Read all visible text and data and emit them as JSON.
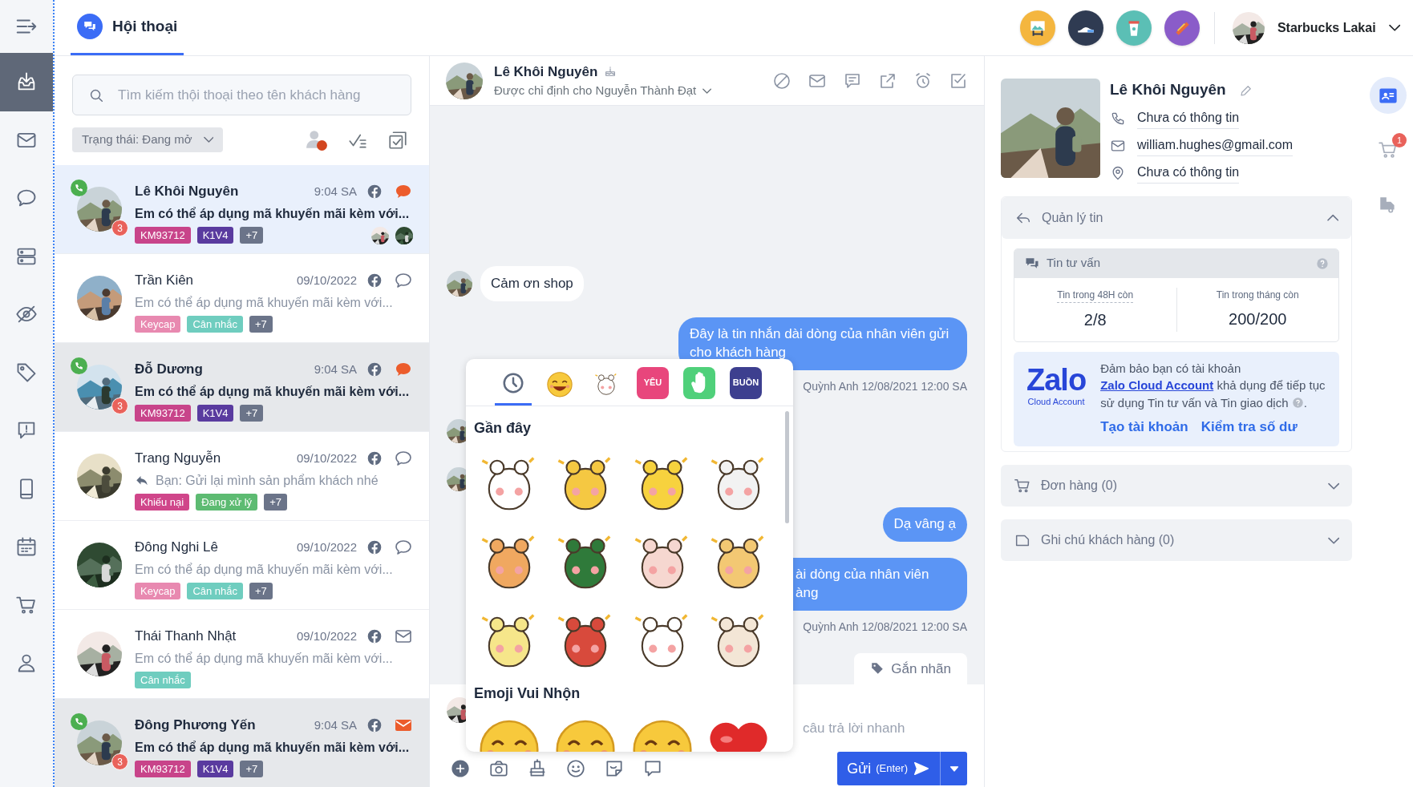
{
  "rail": {
    "items": [
      {
        "kind": "inbox",
        "selected": true
      },
      {
        "kind": "mail",
        "selected": false
      },
      {
        "kind": "chat",
        "selected": false
      },
      {
        "kind": "server",
        "selected": false
      },
      {
        "kind": "eye-off",
        "selected": false
      },
      {
        "kind": "tag",
        "selected": false
      },
      {
        "kind": "alert",
        "selected": false
      },
      {
        "kind": "mobile",
        "selected": false
      },
      {
        "kind": "calendar",
        "selected": false
      },
      {
        "kind": "cart",
        "selected": false
      },
      {
        "kind": "user",
        "selected": false
      }
    ]
  },
  "topbar": {
    "tab": {
      "label": "Hội thoại",
      "selected": true
    },
    "apps": [
      {
        "kind": "frame",
        "color": "#f4b63f"
      },
      {
        "kind": "shoe",
        "color": "#2f3b52"
      },
      {
        "kind": "cup",
        "color": "#5bbfb5"
      },
      {
        "kind": "hotdog",
        "color": "#8a5cc9"
      }
    ],
    "account": {
      "name": "Starbucks Lakai"
    }
  },
  "conversation_list": {
    "search": {
      "placeholder": "Tìm kiếm thội thoại theo tên khách hàng"
    },
    "filter": {
      "label": "Trạng thái: Đang mở"
    },
    "conversations": [
      {
        "name": "Lê Khôi Nguyên",
        "time": "9:04 SA",
        "channel": {
          "kind": "facebook"
        },
        "status_icon": {
          "kind": "chat",
          "new": true
        },
        "preview": "Em có thể áp dụng mã khuyến mãi kèm với...",
        "reply": false,
        "tags": [
          {
            "label": "KM93712",
            "color": "#c8448a"
          },
          {
            "label": "K1V4",
            "color": "#5a3b9f"
          },
          {
            "label": "+7",
            "color": "#6b7489"
          }
        ],
        "unread_count": "3",
        "on_call": true,
        "unread": true,
        "selected": true,
        "assignees": [
          {
            "kind": "picture"
          },
          {
            "kind": "picture"
          }
        ]
      },
      {
        "name": "Trần Kiên",
        "time": "09/10/2022",
        "channel": {
          "kind": "facebook"
        },
        "status_icon": {
          "kind": "chat",
          "new": false
        },
        "preview": "Em có thể áp dụng mã khuyến mãi kèm với...",
        "reply": false,
        "tags": [
          {
            "label": "Keycap",
            "color": "#e889b0"
          },
          {
            "label": "Cân nhắc",
            "color": "#6fcdbf"
          },
          {
            "label": "+7",
            "color": "#6b7489"
          }
        ],
        "on_call": false,
        "unread": false,
        "selected": false
      },
      {
        "name": "Đỗ Dương",
        "time": "9:04 SA",
        "channel": {
          "kind": "facebook"
        },
        "status_icon": {
          "kind": "chat",
          "new": true
        },
        "preview": "Em có thể áp dụng mã khuyến mãi kèm với...",
        "reply": false,
        "tags": [
          {
            "label": "KM93712",
            "color": "#c8448a"
          },
          {
            "label": "K1V4",
            "color": "#5a3b9f"
          },
          {
            "label": "+7",
            "color": "#6b7489"
          }
        ],
        "unread_count": "3",
        "on_call": true,
        "unread": true,
        "selected": false
      },
      {
        "name": "Trang Nguyễn",
        "time": "09/10/2022",
        "channel": {
          "kind": "facebook"
        },
        "status_icon": {
          "kind": "chat",
          "new": false
        },
        "preview": "Bạn: Gửi lại mình sản phẩm khách nhé",
        "reply": true,
        "tags": [
          {
            "label": "Khiếu nại",
            "color": "#d0468a"
          },
          {
            "label": "Đang xử lý",
            "color": "#5dbb72"
          },
          {
            "label": "+7",
            "color": "#6b7489"
          }
        ],
        "on_call": false,
        "unread": false,
        "selected": false
      },
      {
        "name": "Đông Nghi Lê",
        "time": "09/10/2022",
        "channel": {
          "kind": "facebook"
        },
        "status_icon": {
          "kind": "chat",
          "new": false
        },
        "preview": "Em có thể áp dụng mã khuyến mãi kèm với...",
        "reply": false,
        "tags": [
          {
            "label": "Keycap",
            "color": "#e889b0"
          },
          {
            "label": "Cân nhắc",
            "color": "#6fcdbf"
          },
          {
            "label": "+7",
            "color": "#6b7489"
          }
        ],
        "on_call": false,
        "unread": false,
        "selected": false
      },
      {
        "name": "Thái Thanh Nhật",
        "time": "09/10/2022",
        "channel": {
          "kind": "facebook"
        },
        "status_icon": {
          "kind": "mail",
          "new": false
        },
        "preview": "Em có thể áp dụng mã khuyến mãi kèm với...",
        "reply": false,
        "tags": [
          {
            "label": "Cân nhắc",
            "color": "#6fcdbf"
          }
        ],
        "on_call": false,
        "unread": false,
        "selected": false
      },
      {
        "name": "Đông Phương Yến",
        "time": "9:04 SA",
        "channel": {
          "kind": "facebook"
        },
        "status_icon": {
          "kind": "mail",
          "new": true
        },
        "preview": "Em có thể áp dụng mã khuyến mãi kèm với...",
        "reply": false,
        "tags": [
          {
            "label": "KM93712",
            "color": "#c8448a"
          },
          {
            "label": "K1V4",
            "color": "#5a3b9f"
          },
          {
            "label": "+7",
            "color": "#6b7489"
          }
        ],
        "unread_count": "3",
        "on_call": true,
        "unread": true,
        "selected": false
      }
    ]
  },
  "chat": {
    "header": {
      "name": "Lê Khôi Nguyên",
      "assigned": "Được chỉ định cho Nguyễn Thành Đạt"
    },
    "messages": [
      {
        "kind": "in",
        "text": "Cảm ơn shop"
      },
      {
        "kind": "out",
        "lines": [
          "Đây là tin nhắn dài dòng của nhân viên gửi cho khách hàng"
        ],
        "meta": "Quỳnh Anh 12/08/2021 12:00 SA"
      },
      {
        "kind": "avatar"
      },
      {
        "kind": "avatar"
      },
      {
        "kind": "out",
        "lines": [
          "Dạ vâng ạ"
        ]
      },
      {
        "kind": "out-covered",
        "lines": [
          "ài dòng của nhân viên",
          "àng"
        ],
        "meta": "Quỳnh Anh 12/08/2021 12:00 SA"
      }
    ],
    "label_tab": "Gắn nhãn",
    "composer": {
      "placeholder": "câu trả lời nhanh",
      "send": "Gửi",
      "send_hint": "(Enter)"
    },
    "sticker_picker": {
      "tabs": [
        {
          "kind": "clock",
          "selected": true
        },
        {
          "kind": "emoji",
          "selected": false
        },
        {
          "kind": "cats",
          "selected": false
        },
        {
          "kind": "badge",
          "label": "YÊU",
          "color": "#e8467c",
          "selected": false
        },
        {
          "kind": "hand",
          "selected": false
        },
        {
          "kind": "badge",
          "label": "BUỒN",
          "color": "#3d3f8f",
          "selected": false
        }
      ],
      "sections": [
        {
          "title": "Gần đây",
          "stickers": [
            {
              "kind": "picture"
            },
            {
              "kind": "picture"
            },
            {
              "kind": "picture"
            },
            {
              "kind": "picture"
            },
            {
              "kind": "picture"
            },
            {
              "kind": "picture"
            },
            {
              "kind": "picture"
            },
            {
              "kind": "picture"
            },
            {
              "kind": "picture"
            },
            {
              "kind": "picture"
            },
            {
              "kind": "picture"
            },
            {
              "kind": "picture"
            }
          ]
        },
        {
          "title": "Emoji Vui Nhộn",
          "stickers": [
            {
              "kind": "emoji"
            },
            {
              "kind": "emoji"
            },
            {
              "kind": "emoji"
            },
            {
              "kind": "heart"
            }
          ]
        }
      ]
    }
  },
  "customer": {
    "name": "Lê Khôi Nguyên",
    "phone": "Chưa có thông tin",
    "email": "william.hughes@gmail.com",
    "address": "Chưa có thông tin",
    "panels": [
      {
        "kind": "messages",
        "title": "Quản lý tin",
        "expanded": true
      },
      {
        "kind": "orders",
        "title": "Đơn hàng (0)",
        "expanded": false
      },
      {
        "kind": "notes",
        "title": "Ghi chú khách hàng (0)",
        "expanded": false
      }
    ],
    "quota": {
      "title": "Tin tư vấn",
      "stats": [
        {
          "label": "Tin trong 48H còn",
          "value": "2/8"
        },
        {
          "label": "Tin trong tháng còn",
          "value": "200/200"
        }
      ]
    },
    "zalo": {
      "logo": "Zalo",
      "logo_sub": "Cloud Account",
      "before": "Đảm bảo bạn có tài khoản",
      "link": "Zalo Cloud Account",
      "after": "khả dụng để tiếp tục sử dụng Tin tư vấn và Tin giao dịch",
      "end": ".",
      "actions": [
        "Tạo tài khoản",
        "Kiểm tra số dư"
      ]
    }
  },
  "side_rail": {
    "items": [
      {
        "kind": "contact",
        "selected": true
      },
      {
        "kind": "cart",
        "selected": false,
        "badge": "1"
      },
      {
        "kind": "shipping",
        "selected": false
      }
    ]
  }
}
